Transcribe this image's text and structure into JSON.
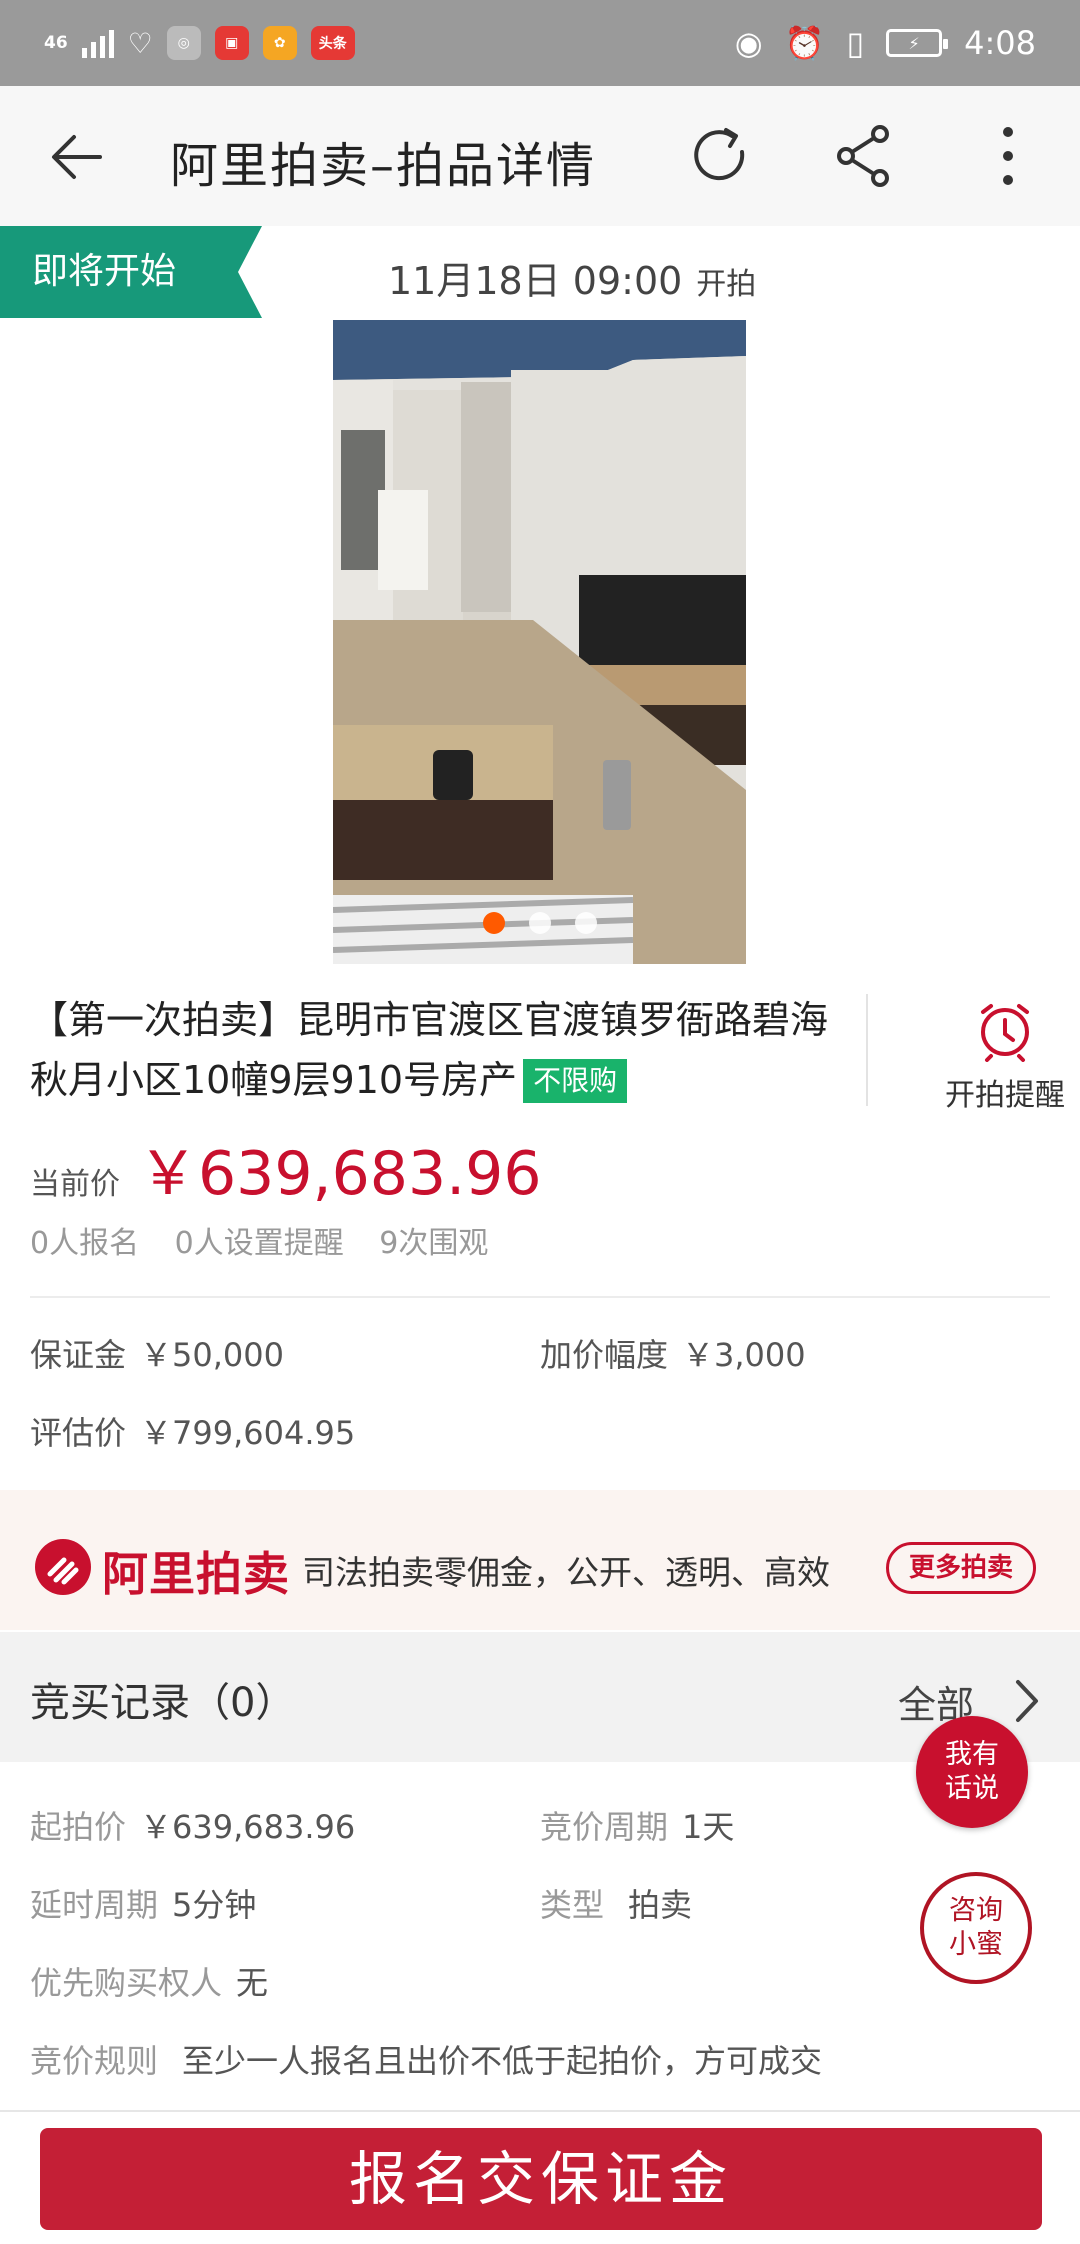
{
  "status_bar": {
    "network": "46",
    "app_badges": [
      "头条"
    ],
    "time": "4:08"
  },
  "header": {
    "title": "阿里拍卖–拍品详情"
  },
  "banner": {
    "status_badge": "即将开始",
    "start_time": "11月18日 09:00",
    "start_suffix": "开拍"
  },
  "gallery": {
    "image_count": 3,
    "active_index": 0
  },
  "lot": {
    "title": "【第一次拍卖】昆明市官渡区官渡镇罗衙路碧海秋月小区10幢9层910号房产",
    "tag": "不限购",
    "remind_label": "开拍提醒",
    "current_price_label": "当前价",
    "current_price": "￥639,683.96",
    "stats": [
      "0人报名",
      "0人设置提醒",
      "9次围观"
    ]
  },
  "terms": {
    "deposit_label": "保证金",
    "deposit": "￥50,000",
    "increment_label": "加价幅度",
    "increment": "￥3,000",
    "appraisal_label": "评估价",
    "appraisal": "￥799,604.95"
  },
  "promo": {
    "brand": "阿里拍卖",
    "slogan": "司法拍卖零佣金，公开、透明、高效",
    "more_button": "更多拍卖"
  },
  "bid_records": {
    "title": "竞买记录（0）",
    "all_link": "全部"
  },
  "details": {
    "starting_price_label": "起拍价",
    "starting_price": "￥639,683.96",
    "period_label": "竞价周期",
    "period": "1天",
    "delay_label": "延时周期",
    "delay": "5分钟",
    "type_label": "类型",
    "type": "拍卖",
    "priority_label": "优先购买权人",
    "priority": "无",
    "rule_label": "竞价规则",
    "rule": "至少一人报名且出价不低于起拍价，方可成交"
  },
  "floating": {
    "comment_line1": "我有",
    "comment_line2": "话说",
    "consult_line1": "咨询",
    "consult_line2": "小蜜"
  },
  "cta": {
    "label": "报名交保证金"
  },
  "colors": {
    "accent_red": "#c8102e",
    "badge_green": "#17997a",
    "tag_green": "#19b36b"
  }
}
